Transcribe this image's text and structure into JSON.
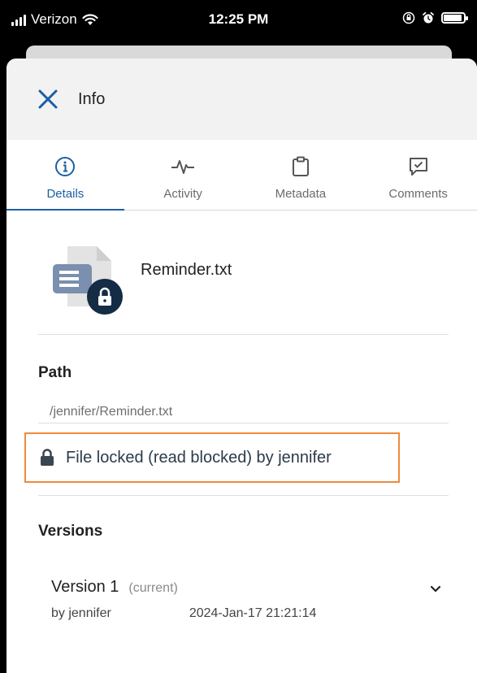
{
  "status_bar": {
    "carrier": "Verizon",
    "time": "12:25 PM",
    "battery_level": 0.9
  },
  "header": {
    "title": "Info",
    "close_icon": "close-icon"
  },
  "tabs": [
    {
      "label": "Details",
      "icon": "info-circle-icon",
      "active": true
    },
    {
      "label": "Activity",
      "icon": "activity-pulse-icon",
      "active": false
    },
    {
      "label": "Metadata",
      "icon": "clipboard-icon",
      "active": false
    },
    {
      "label": "Comments",
      "icon": "comment-check-icon",
      "active": false
    }
  ],
  "file": {
    "name": "Reminder.txt",
    "icon": "locked-text-file-icon"
  },
  "path": {
    "title": "Path",
    "value": "/jennifer/Reminder.txt"
  },
  "lock": {
    "icon": "lock-icon",
    "text": "File locked (read blocked) by jennifer"
  },
  "versions": {
    "title": "Versions",
    "items": [
      {
        "name": "Version 1",
        "status": "(current)",
        "author": "by jennifer",
        "date": "2024-Jan-17 21:21:14"
      }
    ]
  },
  "colors": {
    "accent": "#1c5fa3",
    "highlight_border": "#f08a3c",
    "header_bg": "#f2f2f2",
    "file_icon_badge": "#142c44"
  }
}
